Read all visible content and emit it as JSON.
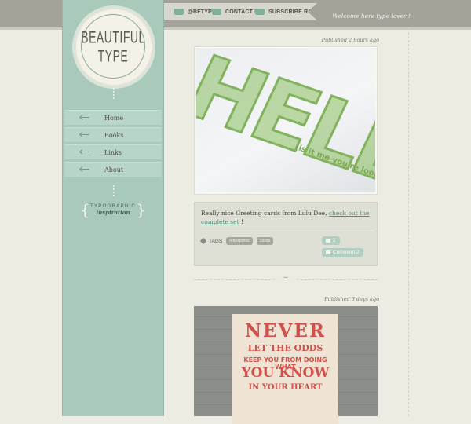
{
  "topbar": {
    "links": [
      {
        "label": "@BFTYPE",
        "icon": "twitter-bird-icon"
      },
      {
        "label": "CONTACT US",
        "icon": "envelope-icon"
      },
      {
        "label": "SUBSCRIBE RSS",
        "icon": "rss-icon"
      }
    ],
    "welcome": "Welcome here type lover !"
  },
  "logo": {
    "line1": "BEAUTIFUL",
    "line2": "TYPE"
  },
  "nav": [
    {
      "label": "Home"
    },
    {
      "label": "Books"
    },
    {
      "label": "Links"
    },
    {
      "label": "About"
    }
  ],
  "tagline": {
    "line1": "TYPOGRAPHIC",
    "line2": "inspiration"
  },
  "posts": [
    {
      "published": "Published 2 hours ago",
      "image_text": {
        "big": "HELLO",
        "sub": "(is it me you're lookin"
      },
      "caption_text": "Really nice Greeting cards from Lulu Dee, ",
      "caption_link": "check out the complete set",
      "caption_end": " !",
      "tags_label": "TAGS",
      "tags": [
        "letterpress",
        "cards"
      ],
      "likes": "2",
      "comment_label": "Comment 2"
    },
    {
      "published": "Published 3 days ago",
      "poster": {
        "l1": "NEVER",
        "l2": "LET THE ODDS",
        "l3": "KEEP YOU FROM DOING WHAT",
        "l4": "YOU KNOW",
        "l5": "IN YOUR HEART"
      }
    }
  ],
  "colors": {
    "sidebar": "#a9c9bb",
    "accent": "#5b8e78",
    "poster_red": "#d0504b"
  }
}
